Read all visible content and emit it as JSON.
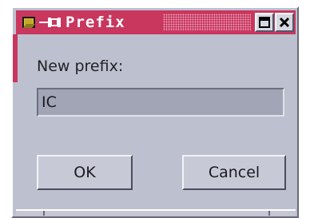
{
  "window": {
    "title": "Prefix",
    "accent_color": "#c9365e"
  },
  "titlebar": {
    "app_icon": "folder-icon",
    "pin_icon": "pin-icon",
    "maximize_icon": "maximize-icon",
    "close_icon": "close-icon"
  },
  "dialog": {
    "label": "New prefix:",
    "input_value": "IC",
    "ok_label": "OK",
    "cancel_label": "Cancel"
  }
}
